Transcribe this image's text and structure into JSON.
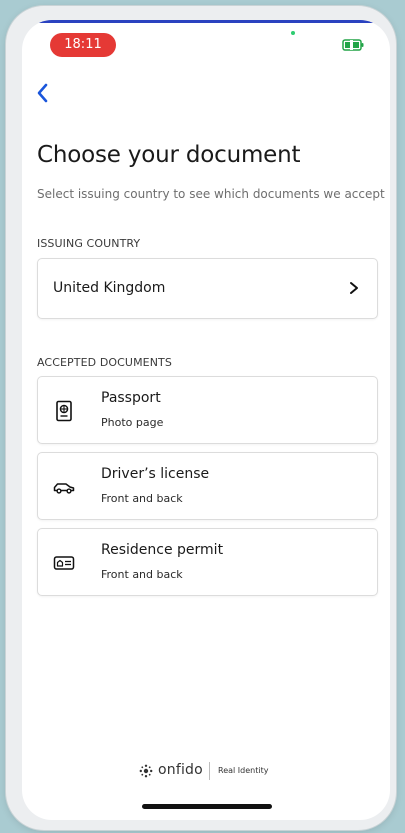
{
  "status_bar": {
    "time": "18:11"
  },
  "header": {
    "back_icon": "chevron-left-icon"
  },
  "page": {
    "title": "Choose your document",
    "subtitle": "Select issuing country to see which documents we accept"
  },
  "issuing_country": {
    "label": "ISSUING COUNTRY",
    "value": "United Kingdom",
    "chevron_icon": "chevron-right-icon"
  },
  "accepted_documents": {
    "label": "ACCEPTED DOCUMENTS",
    "items": [
      {
        "title": "Passport",
        "subtitle": "Photo page",
        "icon": "passport-icon"
      },
      {
        "title": "Driver’s license",
        "subtitle": "Front and back",
        "icon": "car-icon"
      },
      {
        "title": "Residence permit",
        "subtitle": "Front and back",
        "icon": "id-card-icon"
      }
    ]
  },
  "footer": {
    "brand": "onfido",
    "tagline": "Real Identity",
    "logo_icon": "onfido-logo-icon"
  },
  "colors": {
    "accent": "#1a56db",
    "status_pill": "#e53935",
    "background_outer": "#a9cbd1",
    "card_border": "#dcdcdc"
  }
}
